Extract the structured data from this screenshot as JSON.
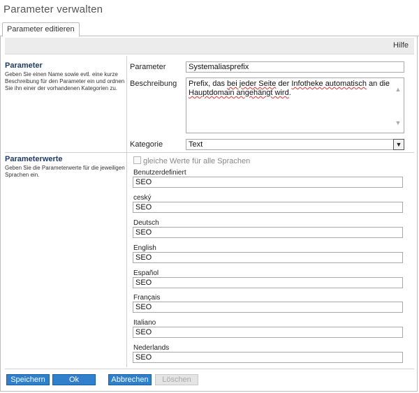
{
  "page": {
    "title": "Parameter verwalten"
  },
  "tabs": [
    {
      "label": "Parameter editieren"
    }
  ],
  "help": {
    "label": "Hilfe"
  },
  "section_parameter": {
    "title": "Parameter",
    "description": "Geben Sie einen Name sowie evtl. eine kurze Beschreibung für den Parameter ein und ordnen Sie ihn einer der vorhandenen Kategorien zu."
  },
  "form": {
    "name_label": "Parameter",
    "name_value": "Systemaliasprefix",
    "description_label": "Beschreibung",
    "description_parts": {
      "p1": "Prefix, das ",
      "s1": "bei jeder Seite",
      "p2": " der ",
      "s2": "Infotheke automatisch",
      "p3": " an die ",
      "s3": "Hauptdomain angehängt wird",
      "p4": "."
    },
    "category_label": "Kategorie",
    "category_value": "Text"
  },
  "section_values": {
    "title": "Parameterwerte",
    "description": "Geben Sie die Parameterwerte für die jeweiligen Sprachen ein."
  },
  "same_values_label": "gleiche Werte für alle Sprachen",
  "languages": [
    {
      "label": "Benutzerdefiniert",
      "value": "SEO"
    },
    {
      "label": "ceský",
      "value": "SEO"
    },
    {
      "label": "Deutsch",
      "value": "SEO"
    },
    {
      "label": "English",
      "value": "SEO"
    },
    {
      "label": "Español",
      "value": "SEO"
    },
    {
      "label": "Français",
      "value": "SEO"
    },
    {
      "label": "Italiano",
      "value": "SEO"
    },
    {
      "label": "Nederlands",
      "value": "SEO"
    }
  ],
  "buttons": {
    "save": "Speichern",
    "ok": "Ok",
    "cancel": "Abbrechen",
    "delete": "Löschen"
  },
  "colors": {
    "accent": "#2f7fcd",
    "section_title": "#1e3a66"
  }
}
